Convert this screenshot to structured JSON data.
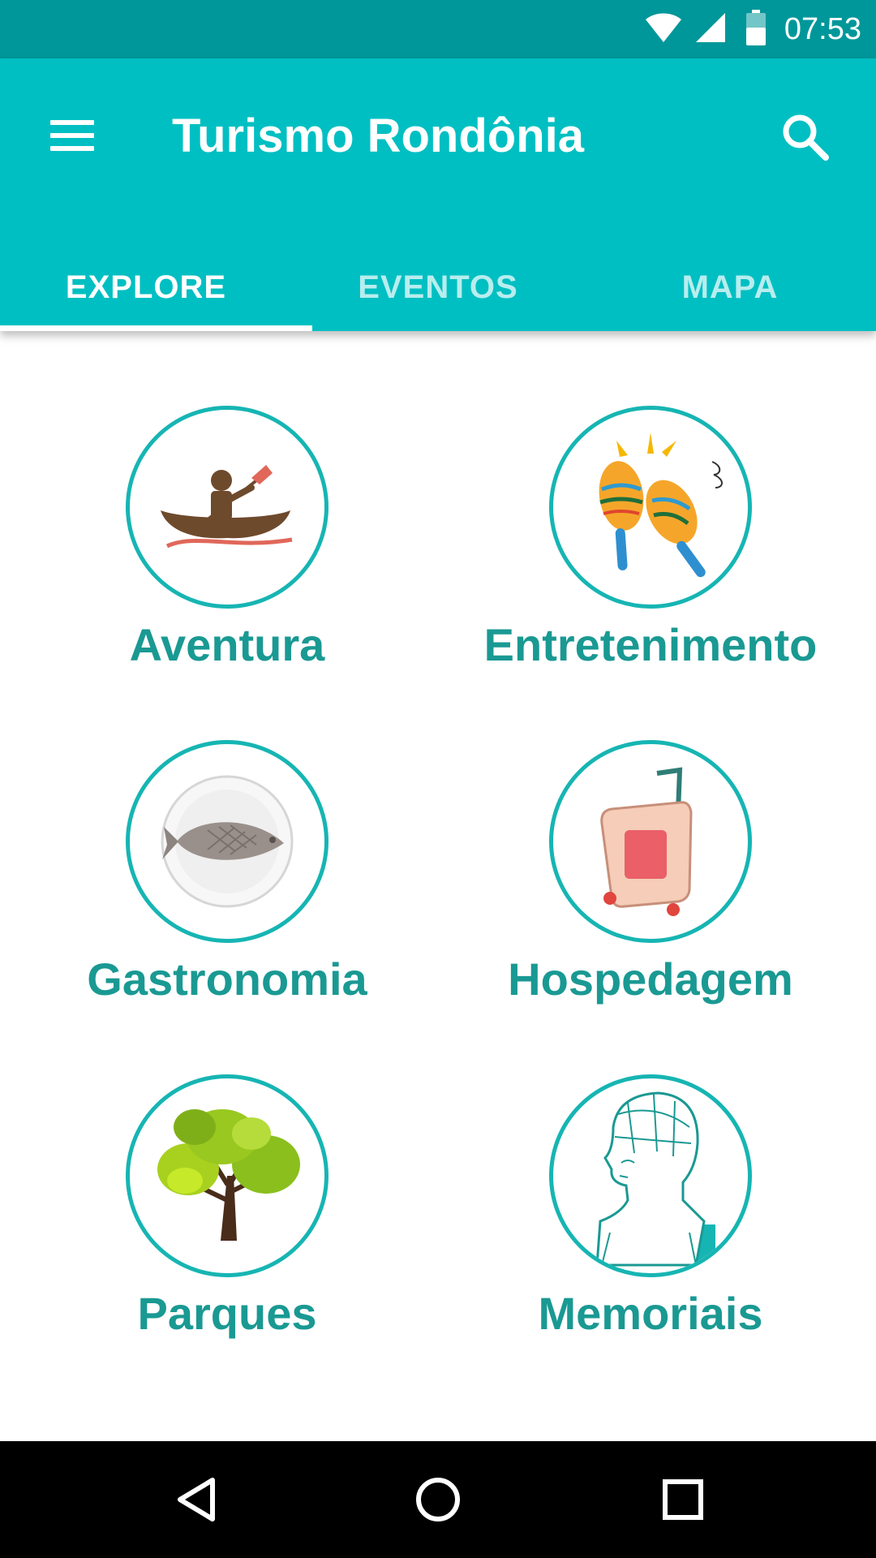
{
  "status_bar": {
    "time": "07:53",
    "icons": [
      "wifi-icon",
      "cell-signal-icon",
      "battery-icon"
    ]
  },
  "app_bar": {
    "title": "Turismo Rondônia",
    "menu_icon": "menu-icon",
    "search_icon": "search-icon",
    "colors": {
      "status": "#00979a",
      "primary": "#00bfc2",
      "accent_text": "#1a9993",
      "circle_border": "#16b5b3"
    }
  },
  "tabs": [
    {
      "label": "EXPLORE",
      "active": true
    },
    {
      "label": "EVENTOS",
      "active": false
    },
    {
      "label": "MAPA",
      "active": false
    }
  ],
  "categories": [
    {
      "label": "Aventura",
      "icon": "canoe-icon"
    },
    {
      "label": "Entretenimento",
      "icon": "maracas-icon"
    },
    {
      "label": "Gastronomia",
      "icon": "fish-plate-icon"
    },
    {
      "label": "Hospedagem",
      "icon": "suitcase-icon"
    },
    {
      "label": "Parques",
      "icon": "tree-icon"
    },
    {
      "label": "Memoriais",
      "icon": "bust-icon"
    }
  ],
  "nav_bar": {
    "icons": [
      "back-icon",
      "home-icon",
      "recents-icon"
    ]
  }
}
